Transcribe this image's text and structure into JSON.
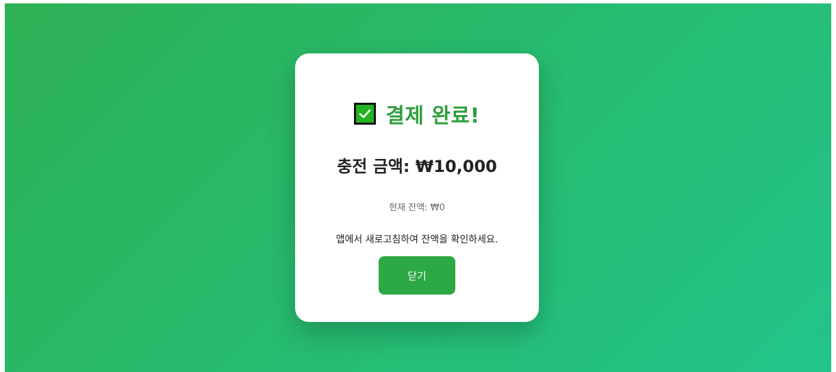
{
  "modal": {
    "title": "결제 완료!",
    "icon": "check-mark-icon",
    "amount_text": "충전 금액: ₩10,000",
    "balance_text": "현재 잔액: ₩0",
    "notice_text": "앱에서 새로고침하여 잔액을 확인하세요.",
    "close_label": "닫기"
  },
  "colors": {
    "background_gradient_start": "#2db155",
    "background_gradient_end": "#23c48a",
    "title_color": "#2e9e3c",
    "button_color": "#2ca844"
  }
}
